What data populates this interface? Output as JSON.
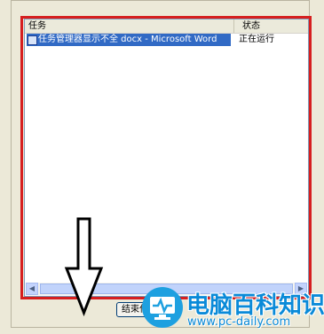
{
  "list": {
    "columns": [
      "任务",
      "状态"
    ],
    "rows": [
      {
        "task": "任务管理器显示不全 docx - Microsoft Word",
        "status": "正在运行"
      }
    ]
  },
  "buttons": {
    "end_task": "结束任务"
  },
  "watermark": {
    "title": "电脑百科知识",
    "url": "www.pc-daily.com"
  },
  "colors": {
    "highlight_box": "#d61f1f",
    "selection": "#316ac5",
    "watermark": "#0a8ad8"
  }
}
